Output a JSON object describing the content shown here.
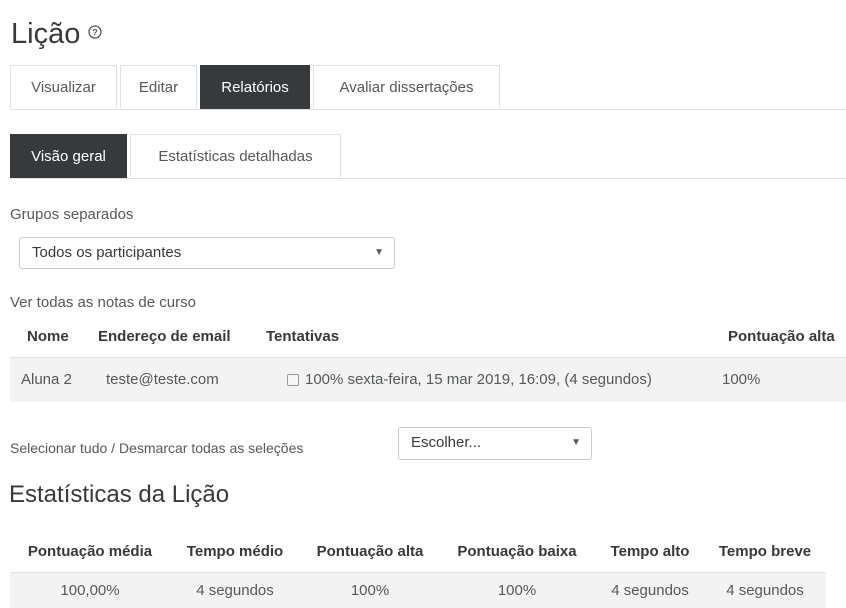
{
  "page": {
    "title": "Lição",
    "help_icon": "question-circle-icon"
  },
  "primary_tabs": [
    {
      "label": "Visualizar",
      "active": false
    },
    {
      "label": "Editar",
      "active": false
    },
    {
      "label": "Relatórios",
      "active": true
    },
    {
      "label": "Avaliar dissertações",
      "active": false
    }
  ],
  "secondary_tabs": [
    {
      "label": "Visão geral",
      "active": true
    },
    {
      "label": "Estatísticas detalhadas",
      "active": false
    }
  ],
  "groups": {
    "label": "Grupos separados",
    "selected": "Todos os participantes"
  },
  "grades_link": "Ver todas as notas de curso",
  "attempts_table": {
    "headers": [
      "Nome",
      "Endereço de email",
      "Tentativas",
      "Pontuação alta"
    ],
    "rows": [
      {
        "name": "Aluna 2",
        "email": "teste@teste.com",
        "attempt": "100% sexta-feira, 15 mar 2019, 16:09, (4 segundos)",
        "high_score": "100%"
      }
    ]
  },
  "bulk": {
    "select_all": "Selecionar tudo",
    "separator": " / ",
    "deselect_all": "Desmarcar todas as seleções",
    "action_selected": "Escolher..."
  },
  "stats": {
    "title": "Estatísticas da Lição",
    "headers": [
      "Pontuação média",
      "Tempo médio",
      "Pontuação alta",
      "Pontuação baixa",
      "Tempo alto",
      "Tempo breve"
    ],
    "values": [
      "100,00%",
      "4 segundos",
      "100%",
      "100%",
      "4 segundos",
      "4 segundos"
    ]
  },
  "colors": {
    "active_tab_bg": "#373a3c",
    "row_bg": "#f3f3f3",
    "border": "#dee2e6"
  }
}
